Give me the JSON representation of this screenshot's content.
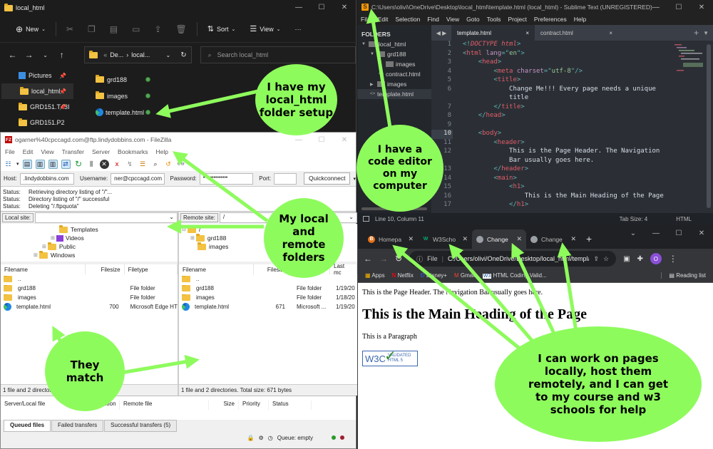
{
  "explorer": {
    "title": "local_html",
    "commands": {
      "new": "New",
      "sort": "Sort",
      "view": "View",
      "more": "···"
    },
    "address": {
      "prefix": "«",
      "parts": [
        "De...",
        "local..."
      ]
    },
    "search_placeholder": "Search local_html",
    "nav_items": [
      {
        "label": "Pictures",
        "icon": "pictures-icon",
        "pinned": true
      },
      {
        "label": "local_html",
        "icon": "folder-icon",
        "pinned": true,
        "selected": true
      },
      {
        "label": "GRD151.T43I",
        "icon": "folder-icon",
        "pinned": true
      },
      {
        "label": "GRD151.P2",
        "icon": "folder-icon",
        "pinned": false
      }
    ],
    "files": [
      {
        "name": "grd188",
        "type": "folder"
      },
      {
        "name": "images",
        "type": "folder"
      },
      {
        "name": "template.html",
        "type": "edge-html"
      }
    ]
  },
  "sublime": {
    "title": "C:\\Users\\olivi\\OneDrive\\Desktop\\local_html\\template.html (local_html) - Sublime Text (UNREGISTERED)",
    "menu": [
      "File",
      "Edit",
      "Selection",
      "Find",
      "View",
      "Goto",
      "Tools",
      "Project",
      "Preferences",
      "Help"
    ],
    "sidebar_header": "FOLDERS",
    "tree": [
      {
        "label": "local_html",
        "indent": 0,
        "toggle": "▼"
      },
      {
        "label": "grd188",
        "indent": 1,
        "toggle": "▼"
      },
      {
        "label": "images",
        "indent": 2,
        "toggle": "▶"
      },
      {
        "label": "contract.html",
        "indent": 2,
        "toggle": "<>"
      },
      {
        "label": "images",
        "indent": 1,
        "toggle": "▶"
      },
      {
        "label": "template.html",
        "indent": 1,
        "toggle": "<>",
        "selected": true
      }
    ],
    "tabs": [
      {
        "label": "template.html",
        "active": true
      },
      {
        "label": "contract.html",
        "active": false
      }
    ],
    "code_lines": [
      {
        "n": "1",
        "html": "<span class='t-punc'>&lt;!</span><span class='t-tag t-it'>DOCTYPE</span> <span class='t-tag t-it'>html</span><span class='t-punc'>&gt;</span>"
      },
      {
        "n": "2",
        "html": "<span class='t-punc'>&lt;</span><span class='t-tag'>html</span> <span class='t-attr'>lang</span><span class='t-punc'>=\"</span><span class='t-str'>en</span><span class='t-punc'>\"&gt;</span>"
      },
      {
        "n": "3",
        "html": "    <span class='t-punc'>&lt;</span><span class='t-tag'>head</span><span class='t-punc'>&gt;</span>"
      },
      {
        "n": "4",
        "html": "        <span class='t-punc'>&lt;</span><span class='t-tag'>meta</span> <span class='t-attr'>charset</span><span class='t-punc'>=\"</span><span class='t-str'>utf-8</span><span class='t-punc'>\"/&gt;</span>"
      },
      {
        "n": "5",
        "html": "        <span class='t-punc'>&lt;</span><span class='t-tag'>title</span><span class='t-punc'>&gt;</span>"
      },
      {
        "n": "6",
        "html": "            Change Me!!! Every page needs a unique"
      },
      {
        "n": "",
        "html": "            title"
      },
      {
        "n": "7",
        "html": "        <span class='t-punc'>&lt;/</span><span class='t-tag'>title</span><span class='t-punc'>&gt;</span>"
      },
      {
        "n": "8",
        "html": "    <span class='t-punc'>&lt;/</span><span class='t-tag'>head</span><span class='t-punc'>&gt;</span>"
      },
      {
        "n": "9",
        "html": ""
      },
      {
        "n": "10",
        "html": "    <span class='t-punc'>&lt;</span><span class='t-tag'>body</span><span class='t-punc'>&gt;</span>",
        "current": true
      },
      {
        "n": "11",
        "html": "        <span class='t-punc'>&lt;</span><span class='t-tag'>header</span><span class='t-punc'>&gt;</span>"
      },
      {
        "n": "12",
        "html": "            This is the Page Header. The Navigation"
      },
      {
        "n": "",
        "html": "            Bar usually goes here."
      },
      {
        "n": "13",
        "html": "        <span class='t-punc'>&lt;/</span><span class='t-tag'>header</span><span class='t-punc'>&gt;</span>"
      },
      {
        "n": "14",
        "html": "        <span class='t-punc'>&lt;</span><span class='t-tag'>main</span><span class='t-punc'>&gt;</span>"
      },
      {
        "n": "15",
        "html": "            <span class='t-punc'>&lt;</span><span class='t-tag'>h1</span><span class='t-punc'>&gt;</span>"
      },
      {
        "n": "16",
        "html": "                This is the Main Heading of the Page"
      },
      {
        "n": "17",
        "html": "            <span class='t-punc'>&lt;/</span><span class='t-tag'>h1</span><span class='t-punc'>&gt;</span>"
      }
    ],
    "status": {
      "position": "Line 10, Column 11",
      "tab_size": "Tab Size: 4",
      "syntax": "HTML"
    }
  },
  "chrome": {
    "tabs": [
      {
        "label": "Homepa",
        "favicon": "B",
        "favicon_color": "#e8711a",
        "active": false
      },
      {
        "label": "W3Scho",
        "favicon": "W",
        "favicon_color": "#04aa6d",
        "active": false
      },
      {
        "label": "Change",
        "favicon": "🌐",
        "favicon_color": "#9aa0a6",
        "active": true
      },
      {
        "label": "Change",
        "favicon": "🌐",
        "favicon_color": "#9aa0a6",
        "active": false
      }
    ],
    "new_tab": "+",
    "url_scheme": "File",
    "url": "C:/Users/olivi/OneDrive/Desktop/local_html/templa...",
    "profile_initial": "O",
    "bookmarks": [
      {
        "label": "Apps",
        "icon": "apps-icon"
      },
      {
        "label": "Netflix",
        "icon": "netflix-icon"
      },
      {
        "label": "Disney+",
        "icon": "disney-icon"
      },
      {
        "label": "Gmail",
        "icon": "gmail-icon"
      },
      {
        "label": "HTML Coding Valid...",
        "icon": "w3-icon"
      }
    ],
    "reading_list": "Reading list",
    "page": {
      "header_text": "This is the Page Header. The Navigation Bar usually goes here.",
      "heading": "This is the Main Heading of the Page",
      "paragraph": "This is a Paragraph",
      "badge_logo": "W3C",
      "badge_line1": "VALIDATED",
      "badge_line2": "HTML 5"
    }
  },
  "filezilla": {
    "title": "ogarner%40cpccagd.com@ftp.lindydobbins.com - FileZilla",
    "menu": [
      "File",
      "Edit",
      "View",
      "Transfer",
      "Server",
      "Bookmarks",
      "Help"
    ],
    "quickconnect": {
      "host_label": "Host:",
      "host": ".lindydobbins.com",
      "user_label": "Username:",
      "user": "ner@cpccagd.com",
      "pass_label": "Password:",
      "pass": "••••••••••••••",
      "port_label": "Port:",
      "port": "",
      "button": "Quickconnect"
    },
    "log": [
      {
        "label": "Status:",
        "text": "Retrieving directory listing of \"/\"..."
      },
      {
        "label": "Status:",
        "text": "Directory listing of \"/\" successful"
      },
      {
        "label": "Status:",
        "text": "Deleting \"/.ftpquota\""
      }
    ],
    "local": {
      "site_label": "Local site:",
      "site_value": "",
      "tree": [
        "Templates",
        "Videos",
        "Public",
        "Windows"
      ],
      "columns": [
        "Filename",
        "Filesize",
        "Filetype"
      ],
      "rows": [
        {
          "name": "..",
          "size": "",
          "type": "",
          "icon": "folder"
        },
        {
          "name": "grd188",
          "size": "",
          "type": "File folder",
          "icon": "folder"
        },
        {
          "name": "images",
          "size": "",
          "type": "File folder",
          "icon": "folder"
        },
        {
          "name": "template.html",
          "size": "700",
          "type": "Microsoft Edge HT",
          "icon": "edge"
        }
      ],
      "summary": "1 file and 2 directories. Total size: 700 bytes"
    },
    "remote": {
      "site_label": "Remote site:",
      "site_value": "/",
      "tree": [
        "/",
        "grd188",
        "images"
      ],
      "columns": [
        "Filename",
        "Filesize",
        "Filetype",
        "Last mc"
      ],
      "rows": [
        {
          "name": "..",
          "size": "",
          "type": "",
          "date": "",
          "icon": "folder"
        },
        {
          "name": "grd188",
          "size": "",
          "type": "File folder",
          "date": "1/19/20",
          "icon": "folder"
        },
        {
          "name": "images",
          "size": "",
          "type": "File folder",
          "date": "1/18/20",
          "icon": "folder"
        },
        {
          "name": "template.html",
          "size": "671",
          "type": "Microsoft ...",
          "date": "1/19/20",
          "icon": "edge"
        }
      ],
      "summary": "1 file and 2 directories. Total size: 671 bytes"
    },
    "queue_columns": [
      "Server/Local file",
      "Direction",
      "Remote file",
      "Size",
      "Priority",
      "Status"
    ],
    "queue_tabs": [
      "Queued files",
      "Failed transfers",
      "Successful transfers (5)"
    ],
    "queue_status": "Queue: empty"
  },
  "annotations": [
    {
      "id": "explorer-note",
      "text": "I have my local_html folder setup"
    },
    {
      "id": "editor-note",
      "text": "I have a code editor on my computer"
    },
    {
      "id": "ftp-note",
      "text": "My local and remote folders"
    },
    {
      "id": "match-note",
      "text": "They match"
    },
    {
      "id": "browser-note",
      "text": "I can work on pages locally, host them remotely, and I can get to my course and w3 schools for help"
    }
  ],
  "colors": {
    "annotation_green": "#8efb5d",
    "sublime_bg": "#2b2f35",
    "chrome_dark": "#202124"
  }
}
